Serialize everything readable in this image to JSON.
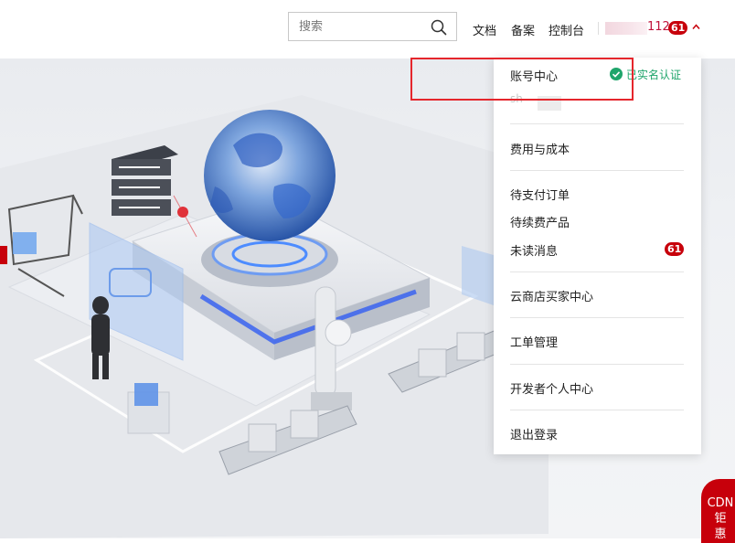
{
  "header": {
    "search": {
      "placeholder": "搜索",
      "value": ""
    },
    "links": [
      "文档",
      "备案",
      "控制台"
    ],
    "user": {
      "name_suffix": "112",
      "badge_count": "61"
    }
  },
  "account_menu": {
    "account_center": "账号中心",
    "verified_label": "已实名认证",
    "faded_text": "sh",
    "billing": "费用与成本",
    "pending_orders": "待支付订单",
    "renewal_products": "待续费产品",
    "unread_messages": "未读消息",
    "unread_count": "61",
    "marketplace": "云商店买家中心",
    "tickets": "工单管理",
    "developer_center": "开发者个人中心",
    "logout": "退出登录"
  },
  "floating_tab": {
    "line1": "CDN",
    "line2": "钜",
    "line3": "惠"
  },
  "colors": {
    "brand_red": "#c7000b",
    "verified_green": "#1fa56b",
    "annotation_red": "#e5262c"
  }
}
